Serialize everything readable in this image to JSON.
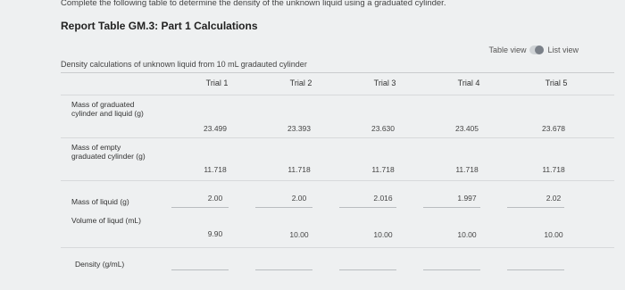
{
  "instruction": "Complete the following table to determine the density of the unknown liquid using a graduated cylinder.",
  "report_title": "Report Table GM.3: Part 1 Calculations",
  "view_toggle": {
    "table_view": "Table view",
    "list_view": "List view"
  },
  "table": {
    "caption": "Density calculations of unknown liquid from 10 mL gradauted cylinder",
    "columns": [
      "Trial 1",
      "Trial 2",
      "Trial 3",
      "Trial 4",
      "Trial 5"
    ],
    "rows": [
      {
        "label": "Mass of graduated cylinder and liquid (g)",
        "values": [
          "23.499",
          "23.393",
          "23.630",
          "23.405",
          "23.678"
        ]
      },
      {
        "label": "Mass of empty graduated cylinder (g)",
        "values": [
          "11.718",
          "11.718",
          "11.718",
          "11.718",
          "11.718"
        ]
      },
      {
        "label": "Mass of liquid (g)",
        "values": [
          "2.00",
          "2.00",
          "2.016",
          "1.997",
          "2.02"
        ]
      },
      {
        "label": "Volume of liqud (mL)",
        "values": [
          "9.90",
          "10.00",
          "10.00",
          "10.00",
          "10.00"
        ]
      },
      {
        "label": "Density (g/mL)",
        "values": [
          "",
          "",
          "",
          "",
          ""
        ]
      }
    ]
  }
}
